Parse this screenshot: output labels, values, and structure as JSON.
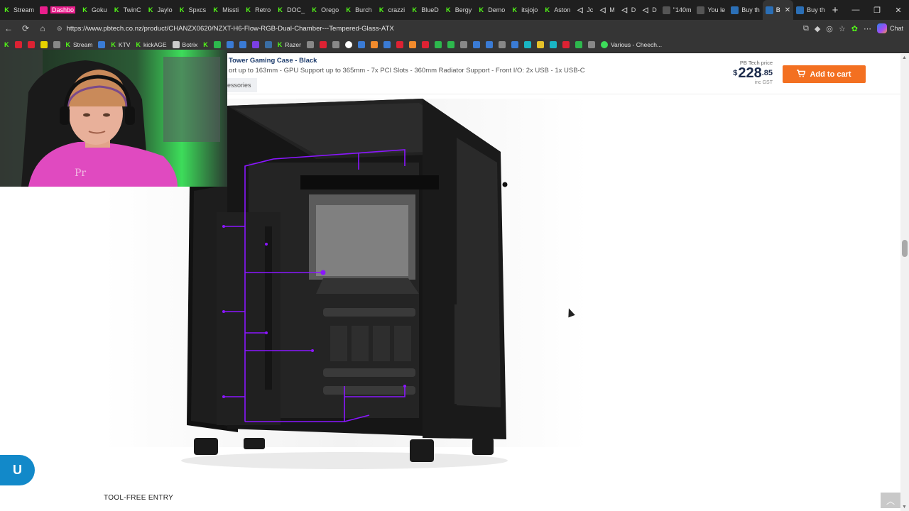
{
  "tabs": [
    {
      "label": "Stream",
      "icon": "kick-icon"
    },
    {
      "label": "Dashbo",
      "icon": "pink-icon",
      "highlight": true
    },
    {
      "label": "Goku",
      "icon": "kick-icon"
    },
    {
      "label": "TwinC",
      "icon": "kick-icon"
    },
    {
      "label": "Jaylo",
      "icon": "kick-icon"
    },
    {
      "label": "Spxcs",
      "icon": "kick-icon"
    },
    {
      "label": "Missti",
      "icon": "kick-icon"
    },
    {
      "label": "Retro",
      "icon": "kick-icon"
    },
    {
      "label": "DOC_",
      "icon": "kick-icon"
    },
    {
      "label": "Orego",
      "icon": "kick-icon"
    },
    {
      "label": "Burch",
      "icon": "kick-icon"
    },
    {
      "label": "crazzi",
      "icon": "kick-icon"
    },
    {
      "label": "BlueD",
      "icon": "kick-icon"
    },
    {
      "label": "Bergy",
      "icon": "kick-icon"
    },
    {
      "label": "Demo",
      "icon": "kick-icon"
    },
    {
      "label": "itsjojo",
      "icon": "kick-icon"
    },
    {
      "label": "Aston",
      "icon": "kick-icon"
    },
    {
      "label": "Jc",
      "icon": "sound-icon"
    },
    {
      "label": "M",
      "icon": "sound-icon"
    },
    {
      "label": "D",
      "icon": "sound-icon"
    },
    {
      "label": "D",
      "icon": "sound-icon"
    },
    {
      "label": "\"140m",
      "icon": "youtube-icon"
    },
    {
      "label": "You le",
      "icon": "youtube-icon"
    },
    {
      "label": "Buy th",
      "icon": "pbtech-icon"
    },
    {
      "label": "B",
      "icon": "pbtech-icon",
      "active": true
    },
    {
      "label": "Buy th",
      "icon": "pbtech-icon"
    }
  ],
  "window_controls": {
    "minimize": "—",
    "restore": "❐",
    "close": "✕"
  },
  "nav": {
    "back": "←",
    "refresh": "⟳",
    "home": "⌂"
  },
  "address": {
    "url": "https://www.pbtech.co.nz/product/CHANZX0620/NZXT-H6-Flow-RGB-Dual-Chamber---Tempered-Glass-ATX"
  },
  "toolbar_right": {
    "chat_label": "Chat"
  },
  "bookmarks": [
    {
      "label": "",
      "icon": "kick-icon"
    },
    {
      "label": "",
      "icon": "red-icon"
    },
    {
      "label": "",
      "icon": "red-icon"
    },
    {
      "label": "",
      "icon": "t-icon"
    },
    {
      "label": "",
      "icon": "gray-icon"
    },
    {
      "label": "Stream",
      "icon": "kick-icon"
    },
    {
      "label": "",
      "icon": "blue-icon"
    },
    {
      "label": "KTV",
      "icon": "kick-icon"
    },
    {
      "label": "kickAGE",
      "icon": "kick-icon"
    },
    {
      "label": "Botrix",
      "icon": "gear-icon"
    },
    {
      "label": "",
      "icon": "kick-icon"
    },
    {
      "label": "",
      "icon": "green-icon"
    },
    {
      "label": "",
      "icon": "blue-icon"
    },
    {
      "label": "",
      "icon": "blue-icon"
    },
    {
      "label": "",
      "icon": "purple-icon"
    },
    {
      "label": "",
      "icon": "steam-icon"
    },
    {
      "label": "Razer",
      "icon": "kick-icon"
    },
    {
      "label": "",
      "icon": "gray-icon"
    },
    {
      "label": "",
      "icon": "red-icon"
    },
    {
      "label": "",
      "icon": "gray-icon"
    },
    {
      "label": "",
      "icon": "google-icon"
    },
    {
      "label": "",
      "icon": "blue-icon"
    },
    {
      "label": "",
      "icon": "orange-icon"
    },
    {
      "label": "",
      "icon": "blue-icon"
    },
    {
      "label": "",
      "icon": "red-icon"
    },
    {
      "label": "",
      "icon": "orange-icon"
    },
    {
      "label": "",
      "icon": "red-icon"
    },
    {
      "label": "",
      "icon": "green-icon"
    },
    {
      "label": "",
      "icon": "green-icon"
    },
    {
      "label": "",
      "icon": "gray-icon"
    },
    {
      "label": "",
      "icon": "blue-icon"
    },
    {
      "label": "",
      "icon": "blue-icon"
    },
    {
      "label": "",
      "icon": "gray-icon"
    },
    {
      "label": "",
      "icon": "blue-icon"
    },
    {
      "label": "",
      "icon": "cyan-icon"
    },
    {
      "label": "",
      "icon": "yellow-icon"
    },
    {
      "label": "",
      "icon": "cyan-icon"
    },
    {
      "label": "",
      "icon": "red-icon"
    },
    {
      "label": "",
      "icon": "green-icon"
    },
    {
      "label": "",
      "icon": "gray-icon"
    },
    {
      "label": "Various - Cheech...",
      "icon": "green-dot-icon"
    }
  ],
  "product": {
    "title": "Tower Gaming Case - Black",
    "specs": "ort up to 163mm - GPU Support up to 365mm - 7x PCI Slots - 360mm Radiator Support - Front I/O: 2x USB - 1x USB-C",
    "tab_label": "essories"
  },
  "price": {
    "label": "PB Tech price",
    "currency": "$",
    "dollars": "228",
    "cents": ".85",
    "tax_note": "inc GST"
  },
  "cart": {
    "label": "Add to cart"
  },
  "section": {
    "title": "TOOL-FREE ENTRY"
  },
  "chat_widget": {
    "glyph": "U"
  },
  "colors": {
    "accent_orange": "#f37021",
    "navy": "#1b3a6b",
    "rgb_purple": "#8a16ff",
    "chrome_dark": "#1f1f1f",
    "chrome_toolbar": "#353535",
    "chat_blue": "#1289c9"
  }
}
